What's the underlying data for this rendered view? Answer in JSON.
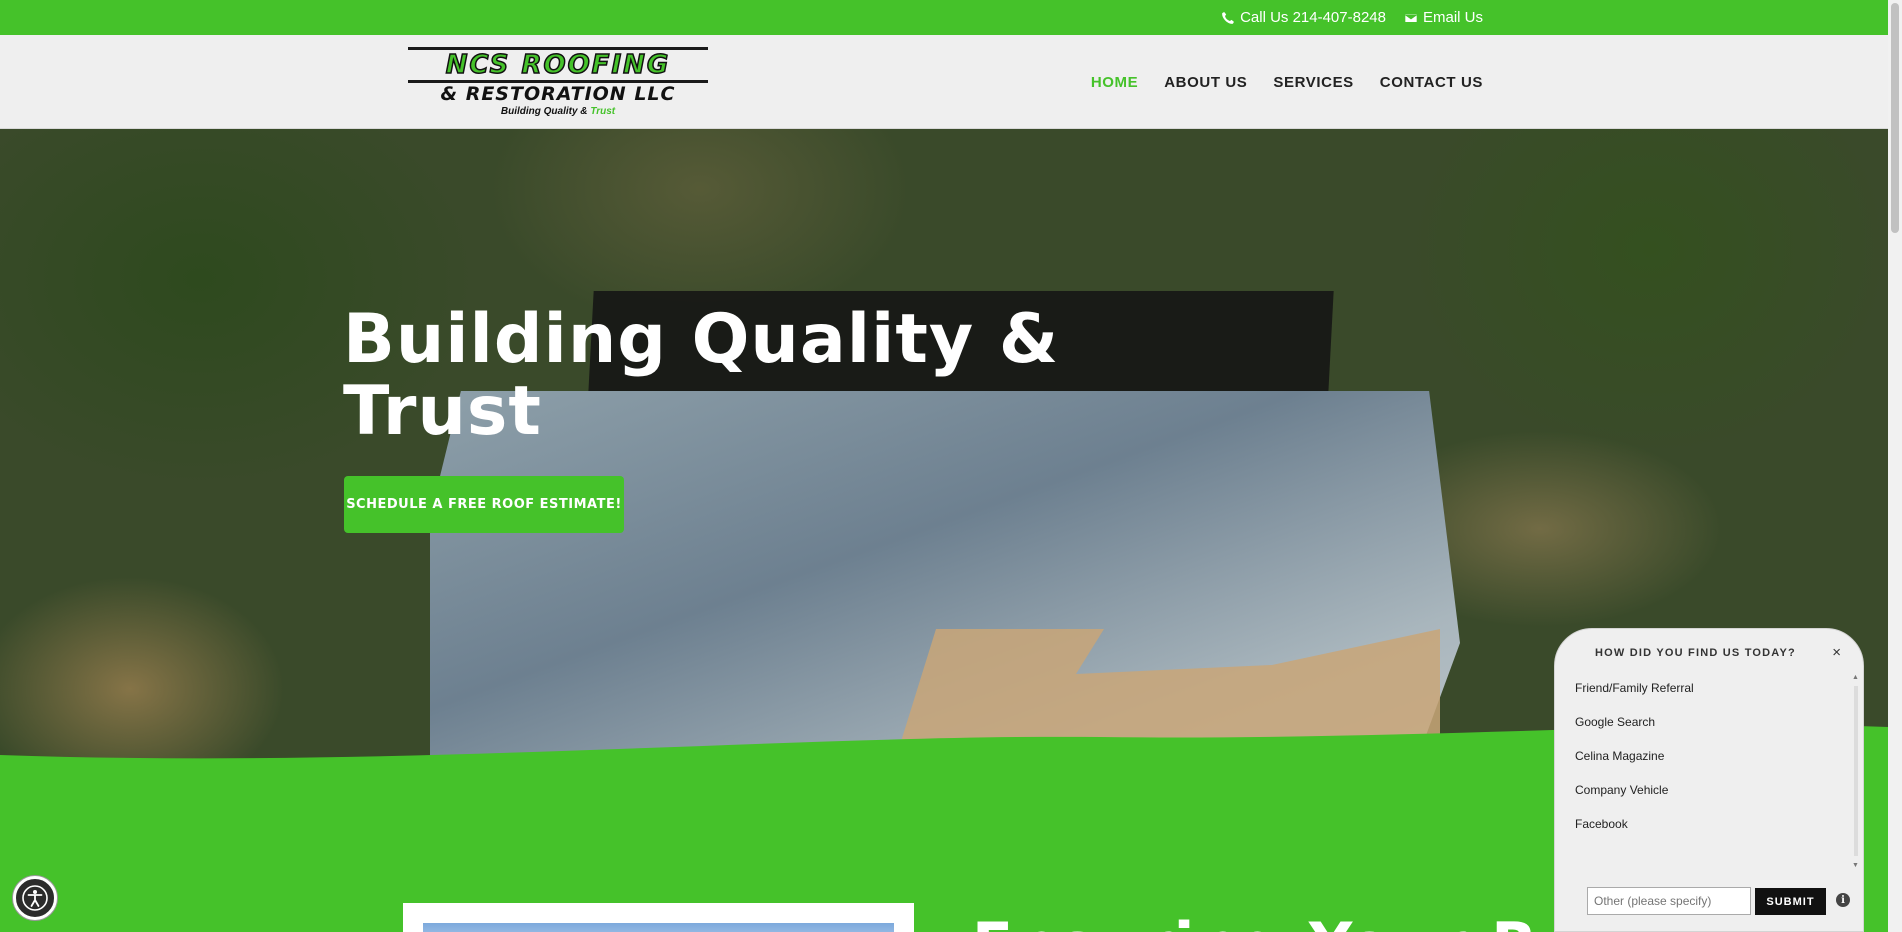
{
  "topbar": {
    "phone_label": "Call Us 214-407-8248",
    "email_label": "Email Us"
  },
  "logo": {
    "line1": "NCS ROOFING",
    "line2": "& RESTORATION LLC",
    "tagline_a": "Building Quality & ",
    "tagline_b": "Trust"
  },
  "nav": {
    "items": [
      "HOME",
      "ABOUT US",
      "SERVICES",
      "CONTACT US"
    ],
    "active": "HOME"
  },
  "hero": {
    "title": "Building Quality & Trust",
    "cta_label": "SCHEDULE A FREE ROOF ESTIMATE!"
  },
  "section": {
    "title": "Ensuring Your Roof"
  },
  "survey": {
    "question": "HOW DID YOU FIND US TODAY?",
    "close": "×",
    "options": [
      "Friend/Family Referral",
      "Google Search",
      "Celina Magazine",
      "Company Vehicle",
      "Facebook"
    ],
    "other_placeholder": "Other (please specify)",
    "submit_label": "SUBMIT",
    "info": "i"
  },
  "colors": {
    "brand_green": "#45c22a",
    "header_bg": "#efefef",
    "text_dark": "#222222"
  },
  "icons": [
    "phone-icon",
    "envelope-icon",
    "accessibility-icon",
    "close-icon",
    "info-icon"
  ]
}
